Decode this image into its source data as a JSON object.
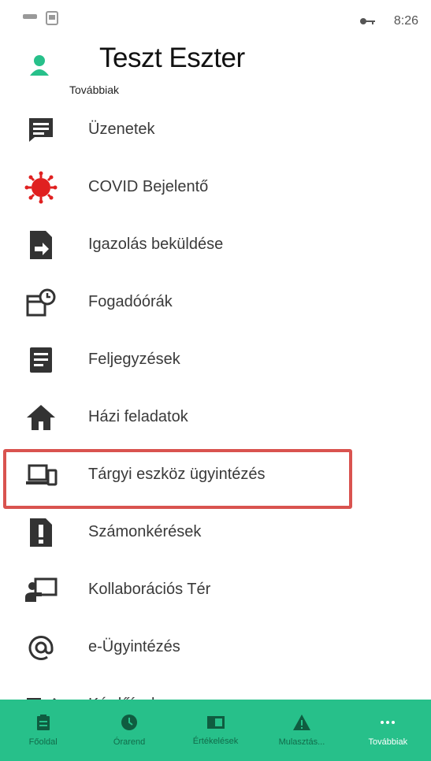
{
  "status_bar": {
    "time": "8:26"
  },
  "header": {
    "user_name": "Teszt Eszter",
    "more_label": "Továbbiak"
  },
  "menu": [
    {
      "label": "Üzenetek",
      "icon": "chat-icon"
    },
    {
      "label": "COVID Bejelentő",
      "icon": "virus-icon"
    },
    {
      "label": "Igazolás beküldése",
      "icon": "document-arrow-icon"
    },
    {
      "label": "Fogadóórák",
      "icon": "calendar-clock-icon"
    },
    {
      "label": "Feljegyzések",
      "icon": "note-icon"
    },
    {
      "label": "Házi feladatok",
      "icon": "home-icon"
    },
    {
      "label": "Tárgyi eszköz ügyintézés",
      "icon": "devices-icon"
    },
    {
      "label": "Számonkérések",
      "icon": "exclamation-doc-icon"
    },
    {
      "label": "Kollaborációs Tér",
      "icon": "presenter-icon"
    },
    {
      "label": "e-Ügyintézés",
      "icon": "at-icon"
    },
    {
      "label": "Kérdőívek",
      "icon": "checklist-icon"
    }
  ],
  "bottom_nav": [
    {
      "label": "Főoldal",
      "icon": "clipboard-icon"
    },
    {
      "label": "Órarend",
      "icon": "clock-icon"
    },
    {
      "label": "Értékelések",
      "icon": "book-icon"
    },
    {
      "label": "Mulasztás...",
      "icon": "warning-icon"
    },
    {
      "label": "Továbbiak",
      "icon": "more-dots-icon",
      "active": true
    }
  ],
  "colors": {
    "accent": "#27c08a",
    "highlight": "#d9534f",
    "avatar": "#27c08a",
    "covid": "#e02020"
  }
}
